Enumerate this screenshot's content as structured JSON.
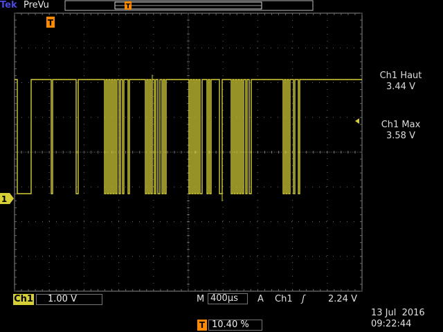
{
  "header": {
    "brand": "Tek",
    "mode": "PreVu"
  },
  "markers": {
    "trigger": "T",
    "channel": "1"
  },
  "measurements": [
    {
      "name": "Ch1 Haut",
      "value": "3.44 V"
    },
    {
      "name": "Ch1 Max",
      "value": "3.58 V"
    }
  ],
  "channel": {
    "label": "Ch1",
    "vscale": "1.00 V"
  },
  "timebase": {
    "prefix": "M",
    "value": "400µs"
  },
  "trigger": {
    "prefix": "A",
    "source": "Ch1",
    "slope_symbol": "ʃ",
    "level": "2.24 V",
    "position": "10.40 %"
  },
  "datetime": {
    "date": "13 Jul  2016",
    "time": "09:22:44"
  },
  "colors": {
    "trace": "#d7cf38",
    "trigger_marker": "#ff8a00",
    "grid": "#6a6a6a"
  }
}
